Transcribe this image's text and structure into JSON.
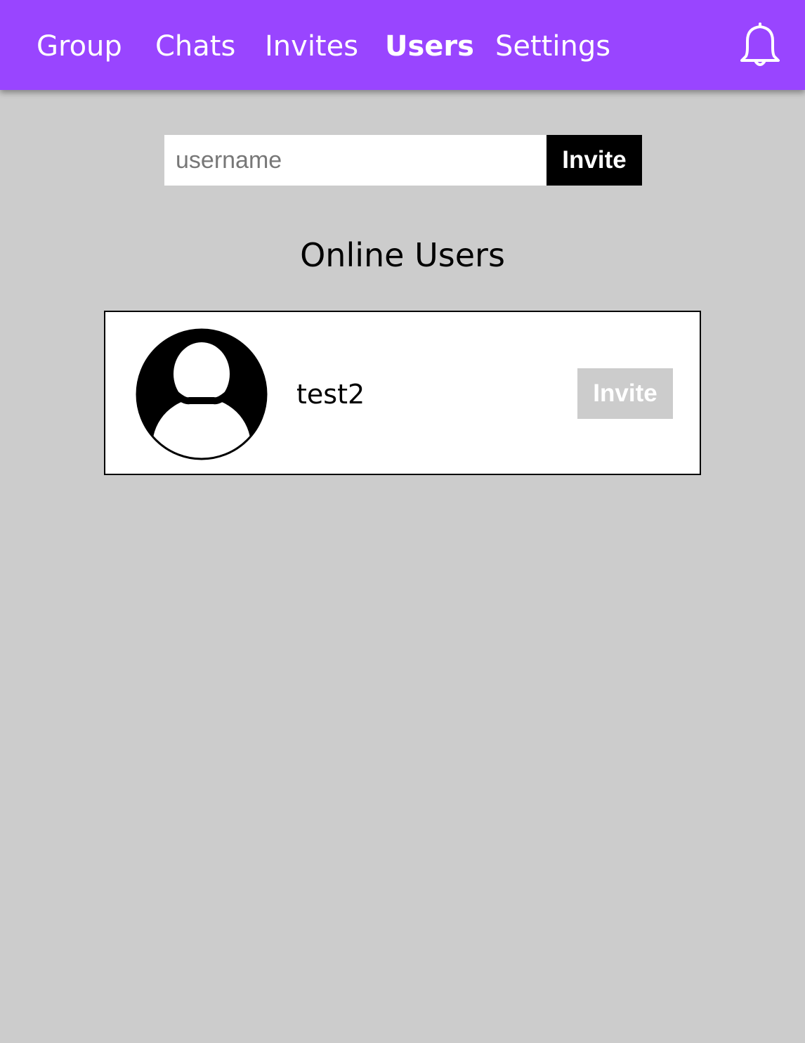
{
  "nav": {
    "items": [
      {
        "label": "Group"
      },
      {
        "label": "Chats"
      },
      {
        "label": "Invites"
      },
      {
        "label": "Users"
      },
      {
        "label": "Settings"
      }
    ],
    "active": "Users",
    "notification_icon": "bell-icon"
  },
  "invite_form": {
    "placeholder": "username",
    "value": "",
    "submit_label": "Invite"
  },
  "online_users": {
    "title": "Online Users",
    "users": [
      {
        "name": "test2",
        "avatar_icon": "user-avatar-icon",
        "invite_label": "Invite"
      }
    ]
  },
  "colors": {
    "topbar": "#9945ff",
    "background": "#cccccc",
    "submit_button": "#000000",
    "disabled_button": "#cccccc",
    "card": "#ffffff"
  }
}
